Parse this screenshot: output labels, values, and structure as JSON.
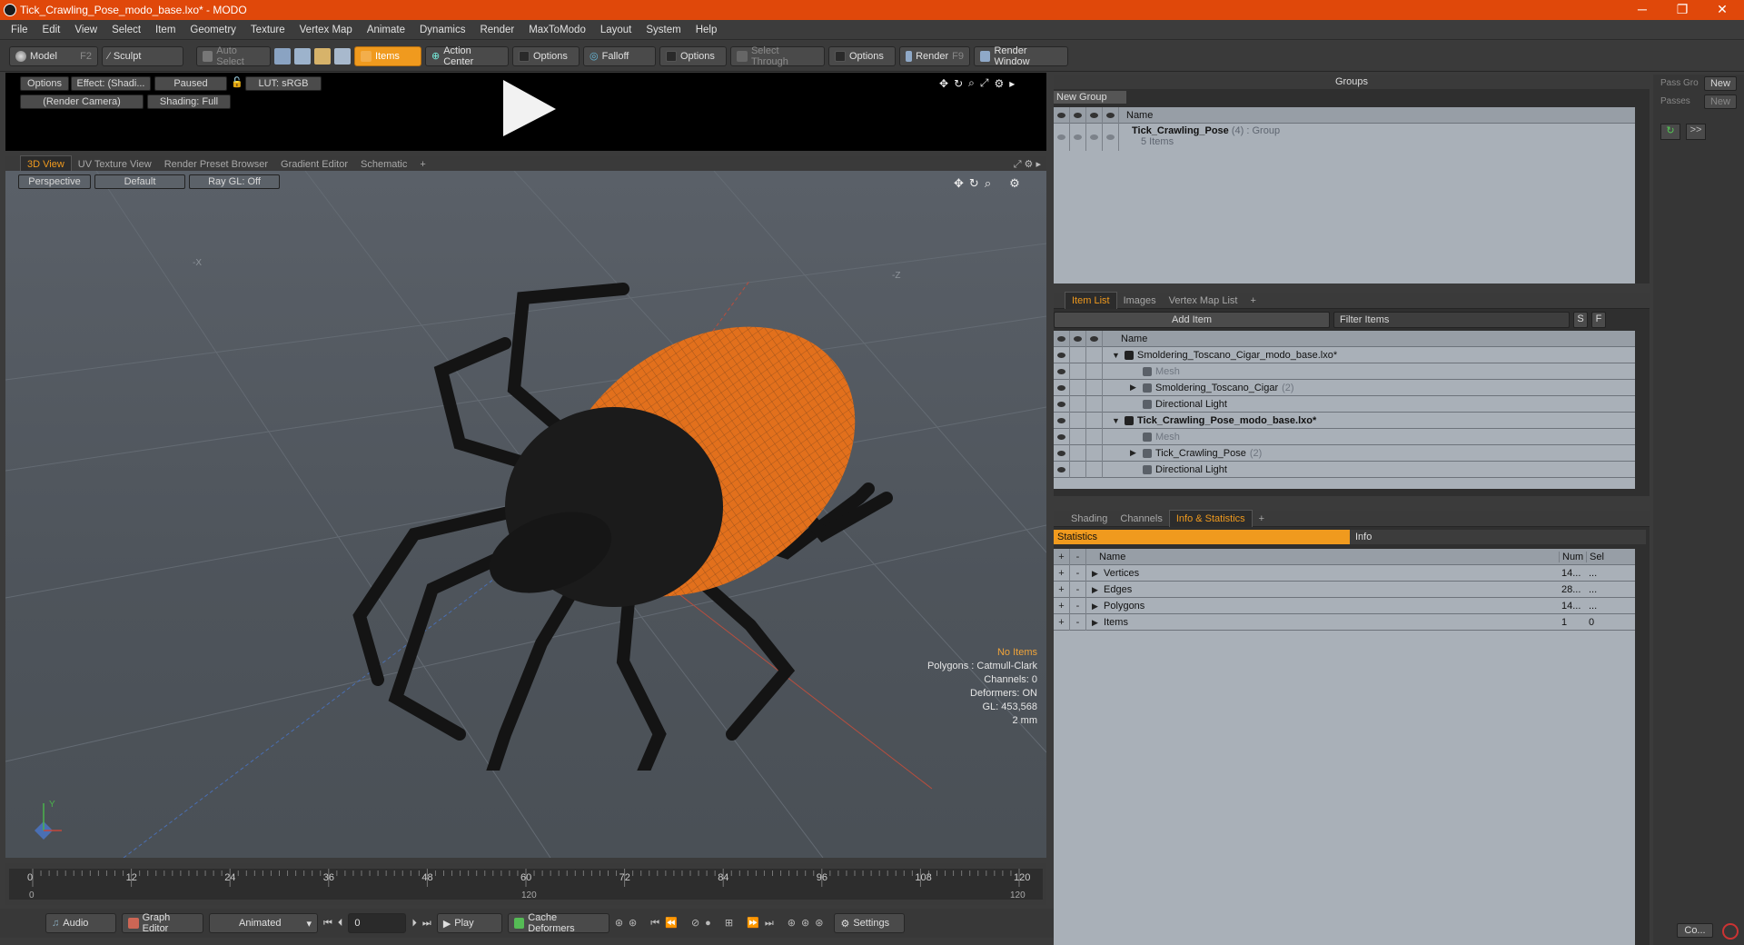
{
  "window": {
    "title": "Tick_Crawling_Pose_modo_base.lxo* - MODO",
    "controls": [
      "─",
      "❐",
      "✕"
    ]
  },
  "menu": [
    "File",
    "Edit",
    "View",
    "Select",
    "Item",
    "Geometry",
    "Texture",
    "Vertex Map",
    "Animate",
    "Dynamics",
    "Render",
    "MaxToModo",
    "Layout",
    "System",
    "Help"
  ],
  "toolbar": {
    "model": "Model",
    "model_key": "F2",
    "sculpt": "Sculpt",
    "auto_select": "Auto Select",
    "items": "Items",
    "action_center": "Action Center",
    "options1": "Options",
    "falloff": "Falloff",
    "options2": "Options",
    "select_through": "Select Through",
    "options3": "Options",
    "render": "Render",
    "render_key": "F9",
    "render_window": "Render Window"
  },
  "render_preview": {
    "options": "Options",
    "effect": "Effect: (Shadi...",
    "paused": "Paused",
    "lut": "LUT: sRGB",
    "camera": "(Render Camera)",
    "shading": "Shading: Full"
  },
  "viewport_tabs": [
    "3D View",
    "UV Texture View",
    "Render Preset Browser",
    "Gradient Editor",
    "Schematic",
    "+"
  ],
  "viewport": {
    "projection": "Perspective",
    "style": "Default",
    "raygl": "Ray GL: Off",
    "axis_x": "-X",
    "axis_z": "-Z",
    "hud": {
      "no_items": "No Items",
      "polygons": "Polygons : Catmull-Clark",
      "channels": "Channels: 0",
      "deformers": "Deformers: ON",
      "gl": "GL: 453,568",
      "scale": "2 mm"
    },
    "gizmo_y": "Y"
  },
  "groups": {
    "title": "Groups",
    "new_group": "New Group",
    "col_name": "Name",
    "row_name": "Tick_Crawling_Pose",
    "row_count": "(4)",
    "row_type": ": Group",
    "row_sub": "5 Items"
  },
  "passes": {
    "pass_label": "Pass Gro",
    "new1": "New",
    "passes": "Passes",
    "new2": "New",
    "arrow": ">>"
  },
  "itemlist": {
    "tabs": [
      "Item List",
      "Images",
      "Vertex Map List",
      "+"
    ],
    "add_item": "Add Item",
    "filter": "Filter Items",
    "s": "S",
    "f": "F",
    "col_name": "Name",
    "rows": [
      {
        "label": "Smoldering_Toscano_Cigar_modo_base.lxo*",
        "indent": 0,
        "bold": false,
        "expand": "▼",
        "eye": true
      },
      {
        "label": "Mesh",
        "indent": 1,
        "dim": true,
        "eye": true
      },
      {
        "label": "Smoldering_Toscano_Cigar",
        "count": "(2)",
        "indent": 1,
        "expand": "▶",
        "eye": true
      },
      {
        "label": "Directional Light",
        "indent": 1,
        "eye": true
      },
      {
        "label": "Tick_Crawling_Pose_modo_base.lxo*",
        "indent": 0,
        "bold": true,
        "expand": "▼",
        "eye": true
      },
      {
        "label": "Mesh",
        "indent": 1,
        "dim": true,
        "eye": true
      },
      {
        "label": "Tick_Crawling_Pose",
        "count": "(2)",
        "indent": 1,
        "expand": "▶",
        "eye": true
      },
      {
        "label": "Directional Light",
        "indent": 1,
        "eye": true
      }
    ]
  },
  "stats": {
    "tabs": [
      "Shading",
      "Channels",
      "Info & Statistics",
      "+"
    ],
    "statistics": "Statistics",
    "info": "Info",
    "cols": [
      "Name",
      "Num",
      "Sel"
    ],
    "rows": [
      {
        "name": "Vertices",
        "num": "14...",
        "sel": "..."
      },
      {
        "name": "Edges",
        "num": "28...",
        "sel": "..."
      },
      {
        "name": "Polygons",
        "num": "14...",
        "sel": "..."
      },
      {
        "name": "Items",
        "num": "1",
        "sel": "0"
      }
    ]
  },
  "timeline": {
    "ticks": [
      "0",
      "12",
      "24",
      "36",
      "48",
      "60",
      "72",
      "84",
      "96",
      "108",
      "120"
    ],
    "bottom_left": "0",
    "bottom_mid": "120",
    "bottom_right": "120"
  },
  "bottombar": {
    "audio": "Audio",
    "graph_editor": "Graph Editor",
    "animated": "Animated",
    "frame": "0",
    "play": "Play",
    "cache": "Cache Deformers",
    "settings": "Settings",
    "co": "Co..."
  },
  "colors": {
    "accent": "#f09a1e",
    "titlebar": "#e0480a"
  }
}
